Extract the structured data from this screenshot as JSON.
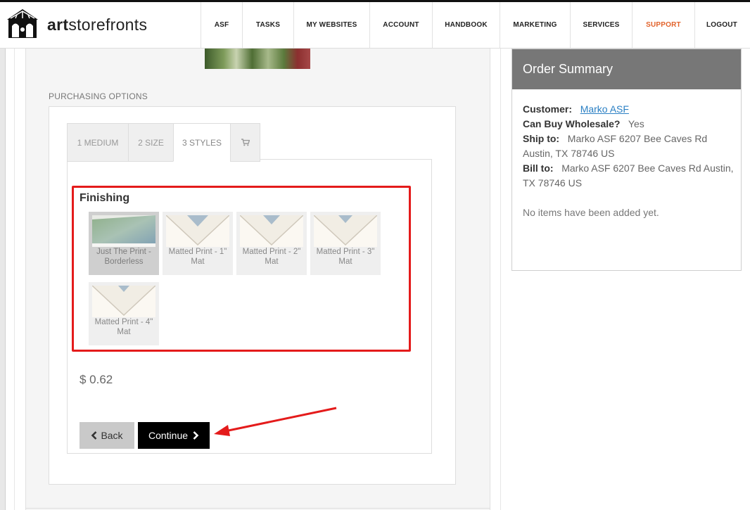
{
  "brand": {
    "name_bold": "art",
    "name_rest": "storefronts"
  },
  "nav": {
    "items": [
      {
        "label": "ASF"
      },
      {
        "label": "TASKS"
      },
      {
        "label": "MY WEBSITES"
      },
      {
        "label": "ACCOUNT"
      },
      {
        "label": "HANDBOOK"
      },
      {
        "label": "MARKETING"
      },
      {
        "label": "SERVICES"
      },
      {
        "label": "SUPPORT"
      },
      {
        "label": "LOGOUT"
      }
    ],
    "support_color": "#e2622a"
  },
  "purchasing": {
    "section_label": "PURCHASING OPTIONS",
    "tabs": [
      {
        "label": "1 MEDIUM"
      },
      {
        "label": "2 SIZE"
      },
      {
        "label": "3 STYLES",
        "active": true
      },
      {
        "label": "",
        "icon": "cart-icon"
      }
    ],
    "finishing_title": "Finishing",
    "options": [
      {
        "label": "Just The Print - Borderless",
        "selected": true
      },
      {
        "label": "Matted Print - 1\" Mat"
      },
      {
        "label": "Matted Print - 2\" Mat"
      },
      {
        "label": "Matted Print - 3\" Mat"
      },
      {
        "label": "Matted Print - 4\" Mat"
      }
    ],
    "price": "$ 0.62",
    "back_label": "Back",
    "continue_label": "Continue"
  },
  "summary": {
    "title": "Order Summary",
    "customer_label": "Customer:",
    "customer_value": "Marko ASF",
    "wholesale_label": "Can Buy Wholesale?",
    "wholesale_value": "Yes",
    "ship_label": "Ship to:",
    "ship_value": "Marko ASF 6207 Bee Caves Rd Austin, TX 78746 US",
    "bill_label": "Bill to:",
    "bill_value": "Marko ASF 6207 Bee Caves Rd Austin, TX 78746 US",
    "empty_text": "No items have been added yet."
  },
  "colors": {
    "accent_red": "#e41b1b",
    "header_gray": "#777777",
    "link_blue": "#2b80c4"
  }
}
